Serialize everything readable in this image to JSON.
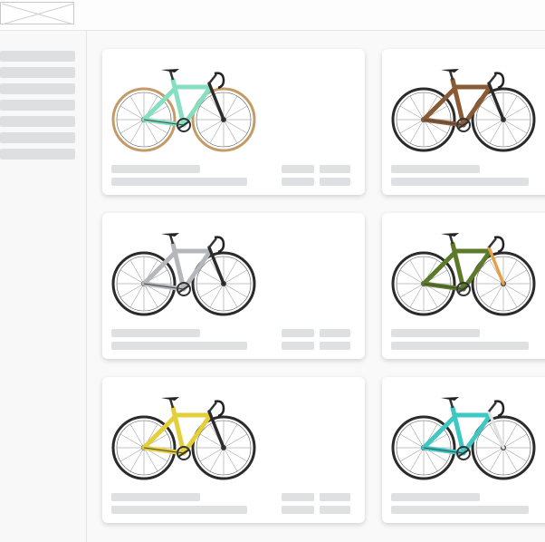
{
  "app": {
    "logo_icon": "image-placeholder-icon",
    "sidebar_item_count": 7
  },
  "products": [
    {
      "frame_color": "#86dfc0",
      "accent_color": "#2b2b2b",
      "tire_color": "#c49b66",
      "type": "road"
    },
    {
      "frame_color": "#8a5a35",
      "accent_color": "#2b2b2b",
      "tire_color": "#2b2b2b",
      "type": "emtb"
    },
    {
      "frame_color": "#b4b7bb",
      "accent_color": "#2b2b2b",
      "tire_color": "#2b2b2b",
      "type": "gravel"
    },
    {
      "frame_color": "#5d7a2a",
      "accent_color": "#e4a04a",
      "tire_color": "#2b2b2b",
      "type": "mtb"
    },
    {
      "frame_color": "#e4cf3a",
      "accent_color": "#2b2b2b",
      "tire_color": "#2b2b2b",
      "type": "mtb"
    },
    {
      "frame_color": "#3ec8c4",
      "accent_color": "#e0e0e0",
      "tire_color": "#2b2b2b",
      "type": "road"
    }
  ]
}
